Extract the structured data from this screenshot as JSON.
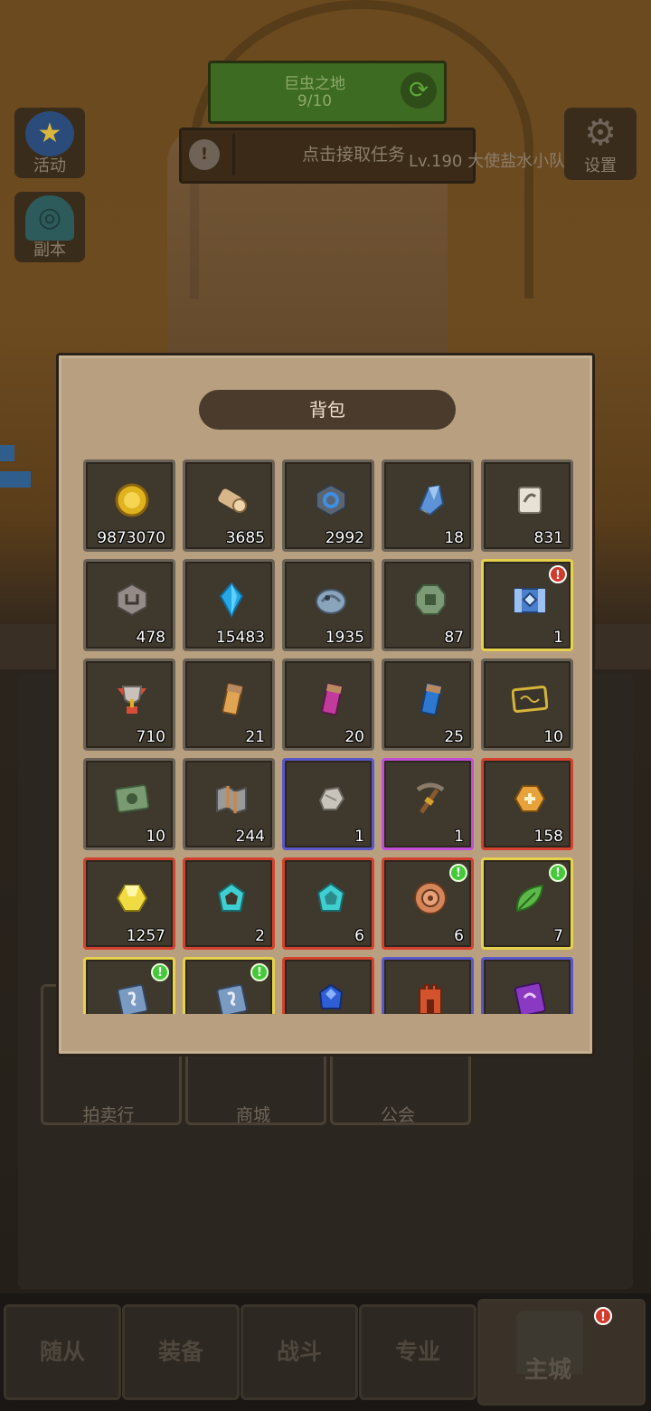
{
  "hud": {
    "map_name": "巨虫之地",
    "map_progress": "9/10",
    "quest_text": "点击接取任务",
    "player_line": "Lv.190 大使盐水小队: ",
    "activity_label": "活动",
    "dungeon_label": "副本",
    "settings_label": "设置"
  },
  "town": {
    "auction_label": "拍卖行",
    "shop_label": "商城",
    "guild_label": "公会"
  },
  "backpack": {
    "title": "背包",
    "items": [
      {
        "icon": "gold-coin-icon",
        "qty": "9873070",
        "rarity": "gray"
      },
      {
        "icon": "wood-log-icon",
        "qty": "3685",
        "rarity": "gray"
      },
      {
        "icon": "blue-rune-stone-icon",
        "qty": "2992",
        "rarity": "gray"
      },
      {
        "icon": "blue-crystal-shard-icon",
        "qty": "18",
        "rarity": "gray"
      },
      {
        "icon": "scroll-icon",
        "qty": "831",
        "rarity": "gray"
      },
      {
        "icon": "gray-rune-stone-icon",
        "qty": "478",
        "rarity": "gray"
      },
      {
        "icon": "blue-diamond-icon",
        "qty": "15483",
        "rarity": "gray"
      },
      {
        "icon": "fossil-icon",
        "qty": "1935",
        "rarity": "gray"
      },
      {
        "icon": "green-coin-icon",
        "qty": "87",
        "rarity": "gray"
      },
      {
        "icon": "treasure-chest-icon",
        "qty": "1",
        "rarity": "yellow",
        "badge": "red"
      },
      {
        "icon": "trophy-icon",
        "qty": "710",
        "rarity": "gray"
      },
      {
        "icon": "orange-potion-icon",
        "qty": "21",
        "rarity": "gray"
      },
      {
        "icon": "pink-potion-icon",
        "qty": "20",
        "rarity": "gray"
      },
      {
        "icon": "blue-potion-icon",
        "qty": "25",
        "rarity": "gray"
      },
      {
        "icon": "golden-ticket-icon",
        "qty": "10",
        "rarity": "gray"
      },
      {
        "icon": "green-ticket-icon",
        "qty": "10",
        "rarity": "gray"
      },
      {
        "icon": "map-icon",
        "qty": "244",
        "rarity": "gray"
      },
      {
        "icon": "ore-icon",
        "qty": "1",
        "rarity": "blue"
      },
      {
        "icon": "pickaxe-icon",
        "qty": "1",
        "rarity": "purple"
      },
      {
        "icon": "orange-gem-icon",
        "qty": "158",
        "rarity": "red"
      },
      {
        "icon": "yellow-gem-icon",
        "qty": "1257",
        "rarity": "red"
      },
      {
        "icon": "cyan-ring-icon",
        "qty": "2",
        "rarity": "red"
      },
      {
        "icon": "cyan-gem-icon",
        "qty": "6",
        "rarity": "red"
      },
      {
        "icon": "copper-coin-icon",
        "qty": "6",
        "rarity": "red",
        "badge": "green"
      },
      {
        "icon": "leaf-icon",
        "qty": "7",
        "rarity": "yellow",
        "badge": "green"
      },
      {
        "icon": "skill-book-icon",
        "qty": "",
        "rarity": "yellow",
        "badge": "green"
      },
      {
        "icon": "skill-book-icon",
        "qty": "",
        "rarity": "yellow",
        "badge": "green"
      },
      {
        "icon": "blue-gem-icon",
        "qty": "",
        "rarity": "red"
      },
      {
        "icon": "tower-icon",
        "qty": "",
        "rarity": "blue"
      },
      {
        "icon": "purple-card-icon",
        "qty": "",
        "rarity": "blue"
      }
    ]
  },
  "nav": {
    "tab1": "随从",
    "tab2": "装备",
    "tab3": "战斗",
    "tab4": "专业",
    "tab5": "主城"
  }
}
